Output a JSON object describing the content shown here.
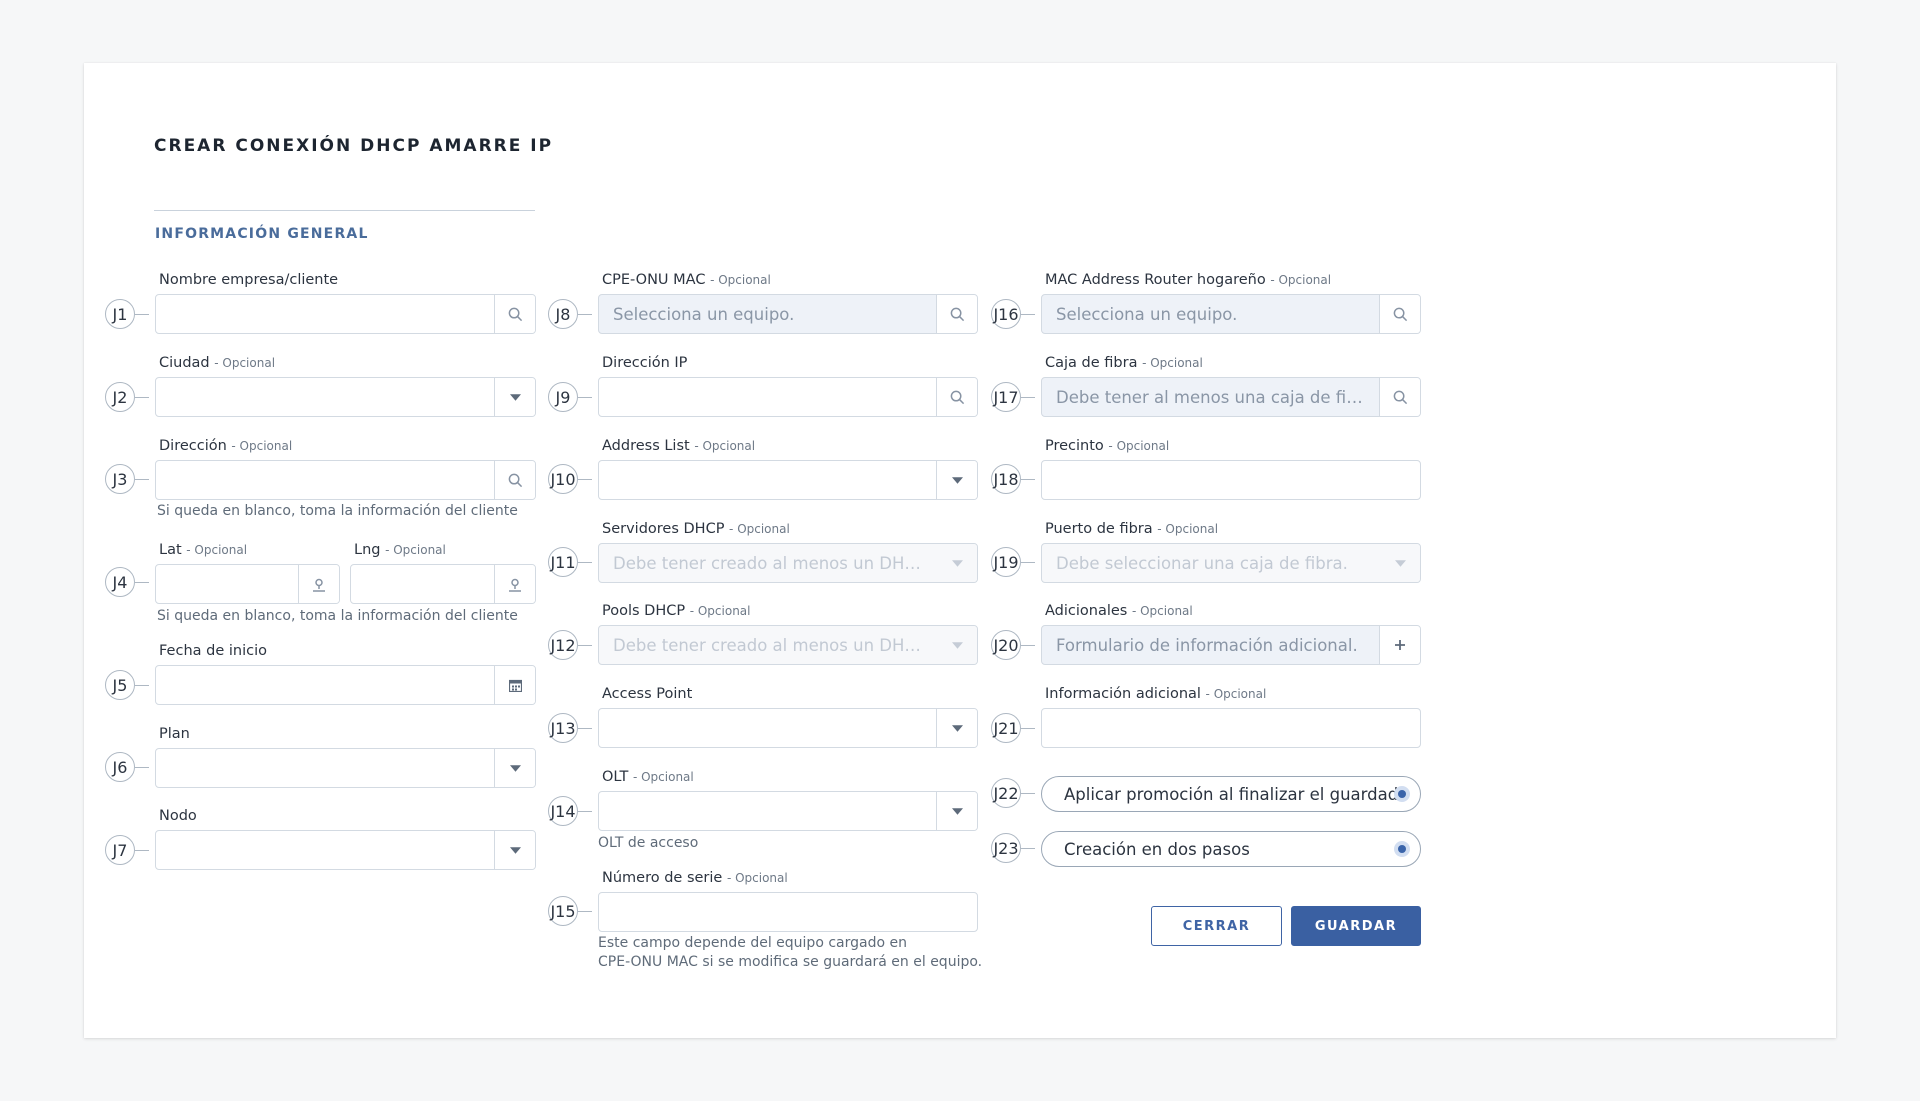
{
  "page": {
    "title": "CREAR CONEXIÓN DHCP AMARRE IP",
    "section_title": "INFORMACIÓN GENERAL"
  },
  "optional_suffix": "- Opcional",
  "markers": [
    "J1",
    "J2",
    "J3",
    "J4",
    "J5",
    "J6",
    "J7",
    "J8",
    "J9",
    "J10",
    "J11",
    "J12",
    "J13",
    "J14",
    "J15",
    "J16",
    "J17",
    "J18",
    "J19",
    "J20",
    "J21",
    "J22",
    "J23"
  ],
  "fields": {
    "client_name": {
      "label": "Nombre empresa/cliente",
      "value": "",
      "icon": "search-icon"
    },
    "city": {
      "label": "Ciudad",
      "value": "",
      "icon": "caret-down-icon"
    },
    "address": {
      "label": "Dirección",
      "value": "",
      "icon": "search-icon",
      "helper": "Si queda en blanco, toma la información del cliente"
    },
    "lat": {
      "label": "Lat",
      "value": "",
      "icon": "map-pin-icon"
    },
    "lng": {
      "label": "Lng",
      "value": "",
      "icon": "map-pin-icon",
      "helper": "Si queda en blanco, toma la información del cliente"
    },
    "start_date": {
      "label": "Fecha de inicio",
      "value": "",
      "icon": "calendar-icon"
    },
    "plan": {
      "label": "Plan",
      "value": "",
      "icon": "caret-down-icon"
    },
    "node": {
      "label": "Nodo",
      "value": "",
      "icon": "caret-down-icon"
    },
    "cpe_onu_mac": {
      "label": "CPE-ONU MAC",
      "placeholder": "Selecciona un equipo.",
      "icon": "search-icon"
    },
    "ip_address": {
      "label": "Dirección IP",
      "value": "",
      "icon": "search-icon"
    },
    "address_list": {
      "label": "Address List",
      "value": "",
      "icon": "caret-down-icon"
    },
    "dhcp_servers": {
      "label": "Servidores DHCP",
      "placeholder": "Debe tener creado al menos un DHCP Ser...",
      "icon": "caret-down-icon"
    },
    "dhcp_pools": {
      "label": "Pools DHCP",
      "placeholder": "Debe tener creado al menos un DHCP Poo...",
      "icon": "caret-down-icon"
    },
    "access_point": {
      "label": "Access Point",
      "value": "",
      "icon": "caret-down-icon"
    },
    "olt": {
      "label": "OLT",
      "value": "",
      "icon": "caret-down-icon",
      "helper": "OLT de acceso"
    },
    "serial_number": {
      "label": "Número de serie",
      "value": "",
      "helper_line1": "Este campo depende del equipo cargado en",
      "helper_line2": "CPE-ONU MAC si se modifica se guardará en el equipo."
    },
    "router_mac": {
      "label": "MAC Address Router hogareño",
      "placeholder": "Selecciona un equipo.",
      "icon": "search-icon"
    },
    "fiber_box": {
      "label": "Caja de fibra",
      "placeholder": "Debe tener al menos una caja de fibra.",
      "icon": "search-icon"
    },
    "seal": {
      "label": "Precinto",
      "value": ""
    },
    "fiber_port": {
      "label": "Puerto de fibra",
      "placeholder": "Debe seleccionar una caja de fibra.",
      "icon": "caret-down-icon"
    },
    "extras": {
      "label": "Adicionales",
      "placeholder": "Formulario de información adicional.",
      "icon": "plus-icon"
    },
    "additional_info": {
      "label": "Información adicional",
      "value": ""
    }
  },
  "options": {
    "apply_promotion": {
      "label": "Aplicar promoción al finalizar el guardado",
      "selected": true
    },
    "two_step_creation": {
      "label": "Creación en dos pasos",
      "selected": true
    }
  },
  "buttons": {
    "close": "CERRAR",
    "save": "GUARDAR"
  },
  "colors": {
    "accent": "#3a60a2",
    "section_title": "#4a6c9b",
    "input_border": "#d3dae2",
    "filled_bg": "#eef2f8"
  }
}
